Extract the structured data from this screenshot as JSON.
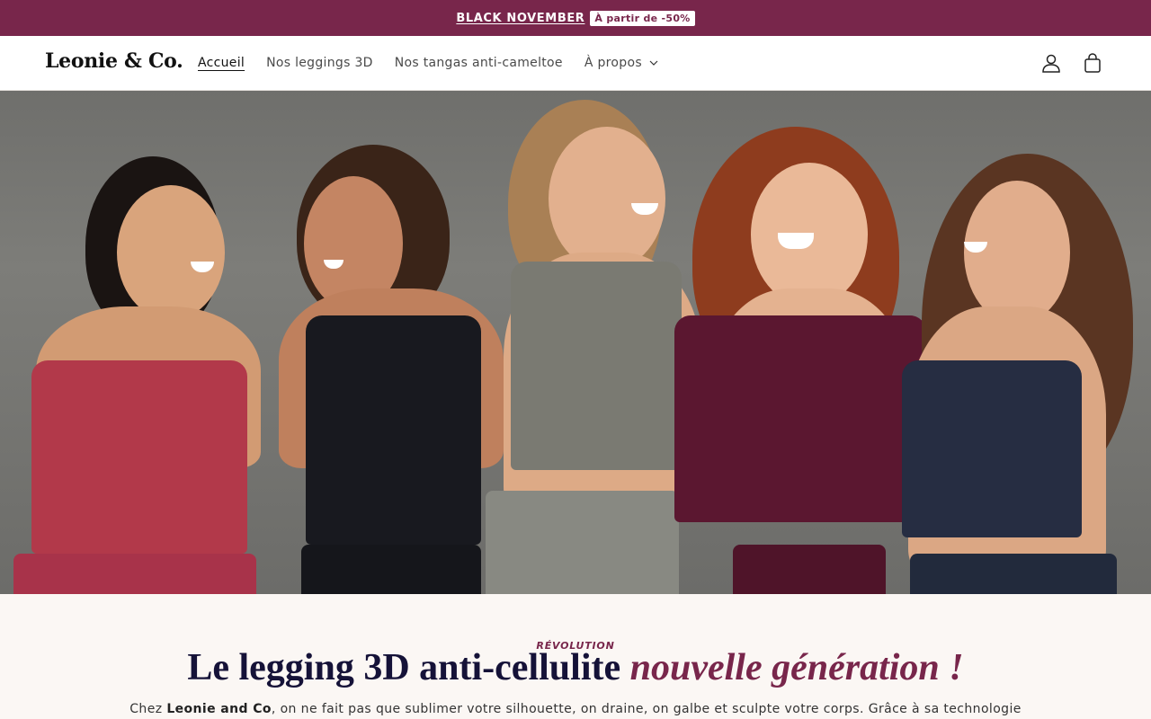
{
  "announcement": {
    "link": "BLACK NOVEMBER",
    "badge": "À partir de -50%"
  },
  "header": {
    "logo": "Leonie & Co.",
    "nav": [
      {
        "label": "Accueil",
        "active": true
      },
      {
        "label": "Nos leggings 3D"
      },
      {
        "label": "Nos tangas anti-cameltoe"
      },
      {
        "label": "À propos",
        "has_dropdown": true
      }
    ],
    "icons": [
      "account-icon",
      "cart-icon"
    ]
  },
  "hero": {
    "image": "five-smiling-women-in-sports-bras-and-leggings"
  },
  "section": {
    "eyebrow": "RÉVOLUTION",
    "headline_plain": "Le legging 3D anti-cellulite ",
    "headline_emphasis": "nouvelle génération !",
    "intro_prefix": "Chez ",
    "intro_brand": "Leonie and Co",
    "intro_suffix": ", on ne fait pas que sublimer votre silhouette, on draine, on galbe et sculpte votre corps. Grâce à sa technologie"
  },
  "colors": {
    "brand": "#78264b",
    "headline": "#151238",
    "background": "#fbf7f4"
  }
}
